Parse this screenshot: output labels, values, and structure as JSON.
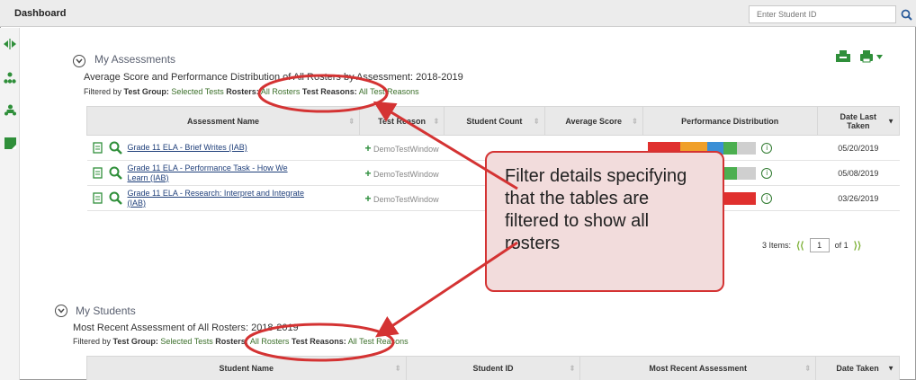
{
  "topbar": {
    "title": "Dashboard",
    "search_placeholder": "Enter Student ID"
  },
  "assessments": {
    "section_title": "My Assessments",
    "subtitle": "Average Score and Performance Distribution of All Rosters by Assessment: 2018-2019",
    "filter": {
      "prefix": "Filtered by",
      "test_group_label": "Test Group:",
      "test_group_value": "Selected Tests",
      "rosters_label": "Rosters:",
      "rosters_value": "All Rosters",
      "reasons_label": "Test Reasons:",
      "reasons_value": "All Test Reasons"
    },
    "columns": [
      "Assessment Name",
      "Test Reason",
      "Student Count",
      "Average Score",
      "Performance Distribution",
      "Date Last Taken"
    ],
    "rows": [
      {
        "name": "Grade 11 ELA - Brief Writes (IAB)",
        "reason": "DemoTestWindow",
        "date": "05/20/2019",
        "distribution": [
          30,
          25,
          15,
          12,
          18
        ]
      },
      {
        "name": "Grade 11 ELA - Performance Task - How We Learn (IAB)",
        "reason": "DemoTestWindow",
        "date": "05/08/2019",
        "distribution": [
          30,
          25,
          15,
          12,
          18
        ]
      },
      {
        "name": "Grade 11 ELA - Research: Interpret and Integrate (IAB)",
        "reason": "DemoTestWindow",
        "date": "03/26/2019",
        "distribution": [
          100
        ]
      }
    ],
    "pager": {
      "items_label": "3 Items:",
      "page": "1",
      "of_label": "of 1"
    }
  },
  "students": {
    "section_title": "My Students",
    "subtitle": "Most Recent Assessment of All Rosters: 2018-2019",
    "filter": {
      "prefix": "Filtered by",
      "test_group_label": "Test Group:",
      "test_group_value": "Selected Tests",
      "rosters_label": "Rosters:",
      "rosters_value": "All Rosters",
      "reasons_label": "Test Reasons:",
      "reasons_value": "All Test Reasons"
    },
    "columns": [
      "Student Name",
      "Student ID",
      "Most Recent Assessment",
      "Date Taken"
    ]
  },
  "callout": {
    "text": "Filter details specifying that the tables are filtered to show all rosters"
  },
  "colors": {
    "annotation_red": "#d43333",
    "callout_fill": "#f2dcdc",
    "filter_value": "#3b6f2a",
    "link": "#1f3f7a",
    "perf_red": "#e0302e",
    "perf_orange": "#f0a02a",
    "perf_blue": "#3a8fd6",
    "perf_green": "#4caf50",
    "perf_grey": "#cfcfcf"
  }
}
